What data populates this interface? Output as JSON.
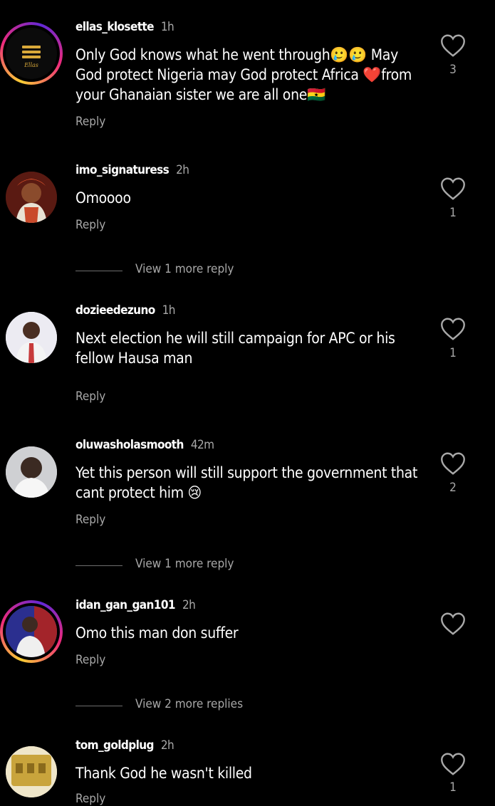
{
  "comments": [
    {
      "username": "ellas_klosette",
      "time": "1h",
      "text": "Only God knows what he went through🥲🥲 May God protect Nigeria may God protect Africa ❤️from your Ghanaian sister we are all one🇬🇭",
      "reply": "Reply",
      "likes": "3",
      "avatar_logo_text": "Ellas"
    },
    {
      "username": "imo_signaturess",
      "time": "2h",
      "text": "Omoooo",
      "reply": "Reply",
      "likes": "1",
      "view_more": "View 1 more reply"
    },
    {
      "username": "dozieedezuno",
      "time": "1h",
      "text": "Next election he will still campaign for APC or his fellow Hausa man",
      "reply": "Reply",
      "likes": "1"
    },
    {
      "username": "oluwasholasmooth",
      "time": "42m",
      "text": "Yet this person will still support the government that cant protect him 😢",
      "reply": "Reply",
      "likes": "2",
      "view_more": "View 1 more reply"
    },
    {
      "username": "idan_gan_gan101",
      "time": "2h",
      "text": "Omo this man don suffer",
      "reply": "Reply",
      "likes": "",
      "view_more": "View 2 more replies"
    },
    {
      "username": "tom_goldplug",
      "time": "2h",
      "text": "Thank God he wasn't killed",
      "reply": "Reply",
      "likes": "1"
    }
  ],
  "colors": {
    "background": "#000000",
    "text": "#ffffff",
    "secondary": "#a8a8a8",
    "story_ring_start": "#f9ce34",
    "story_ring_mid": "#ee2a7b"
  },
  "icons": {
    "like": "heart-outline-icon"
  }
}
